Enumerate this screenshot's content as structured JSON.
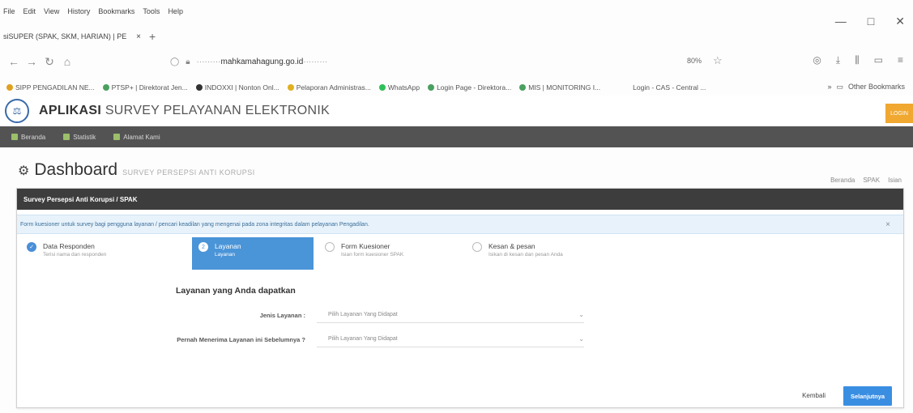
{
  "browser": {
    "menu": [
      "File",
      "Edit",
      "View",
      "History",
      "Bookmarks",
      "Tools",
      "Help"
    ],
    "window_controls": {
      "minimize": "—",
      "maximize": "□",
      "close": "✕"
    },
    "tab": {
      "title": "siSUPER (SPAK, SKM, HARIAN) | PE",
      "close": "×"
    },
    "new_tab": "+",
    "url_domain": "mahkamahagung.go.id",
    "zoom": "80%",
    "bookmarks": [
      {
        "label": "SIPP PENGADILAN NE...",
        "color": "#e0a020"
      },
      {
        "label": "PTSP+ | Direktorat Jen...",
        "color": "#4aa060"
      },
      {
        "label": "INDOXXI | Nonton Onl...",
        "color": "#333333"
      },
      {
        "label": "Pelaporan Administras...",
        "color": "#e0b020"
      },
      {
        "label": "WhatsApp",
        "color": "#2fbf5a"
      },
      {
        "label": "Login Page - Direktora...",
        "color": "#4aa060"
      },
      {
        "label": "MIS | MONITORING I...",
        "color": "#4aa060"
      },
      {
        "label": "Login - CAS - Central ...",
        "color": "#dddddd"
      }
    ],
    "other_bookmarks": "Other Bookmarks"
  },
  "app": {
    "title_bold": "APLIKASI",
    "title_rest": "SURVEY PELAYANAN ELEKTRONIK",
    "login_label": "LOGIN",
    "nav": [
      "Beranda",
      "Statistik",
      "Alamat Kami"
    ]
  },
  "page": {
    "title": "Dashboard",
    "subtitle": "SURVEY PERSEPSI ANTI KORUPSI",
    "breadcrumb": [
      "Beranda",
      "SPAK",
      "Isian"
    ]
  },
  "panel": {
    "heading": "Survey Persepsi Anti Korupsi / SPAK",
    "alert": "Form kuesioner untuk survey bagi pengguna layanan / pencari keadilan yang mengenai pada zona integritas dalam pelayanan Pengadilan.",
    "alert_close": "×",
    "steps": [
      {
        "label": "Data Responden",
        "desc": "Terisi nama dan responden",
        "state": "done"
      },
      {
        "label": "Layanan",
        "desc": "Layanan",
        "state": "active",
        "num": "2"
      },
      {
        "label": "Form Kuesioner",
        "desc": "Isian form kuesioner SPAK",
        "state": "pending"
      },
      {
        "label": "Kesan & pesan",
        "desc": "Isikan di kesan dan pesan Anda",
        "state": "pending"
      }
    ],
    "form_title": "Layanan yang Anda dapatkan",
    "fields": [
      {
        "label": "Jenis Layanan",
        "placeholder": "Pilih Layanan Yang Didapat"
      },
      {
        "label": "Pernah Menerima Layanan ini Sebelumnya ?",
        "placeholder": "Pilih Layanan Yang Didapat"
      }
    ],
    "back_label": "Kembali",
    "next_label": "Selanjutnya"
  }
}
